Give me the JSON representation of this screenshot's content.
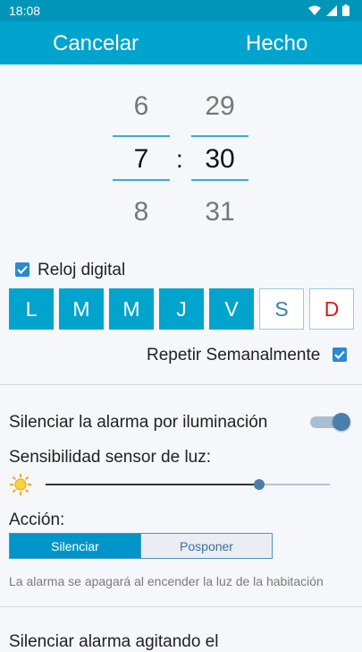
{
  "status_bar": {
    "time": "18:08"
  },
  "header": {
    "cancel_label": "Cancelar",
    "done_label": "Hecho"
  },
  "picker": {
    "hour": {
      "prev": "6",
      "current": "7",
      "next": "8"
    },
    "separator": ":",
    "minute": {
      "prev": "29",
      "current": "30",
      "next": "31"
    }
  },
  "digital_clock": {
    "label": "Reloj digital",
    "checked": true
  },
  "days": [
    {
      "label": "L",
      "selected": true,
      "color": "#ffffff"
    },
    {
      "label": "M",
      "selected": true,
      "color": "#ffffff"
    },
    {
      "label": "M",
      "selected": true,
      "color": "#ffffff"
    },
    {
      "label": "J",
      "selected": true,
      "color": "#ffffff"
    },
    {
      "label": "V",
      "selected": true,
      "color": "#ffffff"
    },
    {
      "label": "S",
      "selected": false,
      "color": "#3d7bb2"
    },
    {
      "label": "D",
      "selected": false,
      "color": "#d8201c"
    }
  ],
  "repeat_weekly": {
    "label": "Repetir Semanalmente",
    "checked": true
  },
  "light_silence": {
    "label": "Silenciar la alarma por iluminación",
    "enabled": true,
    "sensitivity_label": "Sensibilidad sensor de luz:",
    "sensitivity_level": 0.75,
    "action_label": "Acción:",
    "actions": [
      "Silenciar",
      "Posponer"
    ],
    "selected_action": "Silenciar",
    "hint": "La alarma se apagará al encender la luz de la habitación"
  },
  "shake_silence": {
    "label": "Silenciar alarma agitando el"
  },
  "colors": {
    "accent": "#00a4cc",
    "status_bar": "#0095b9",
    "sunday": "#d8201c",
    "saturday": "#3d7bb2"
  }
}
